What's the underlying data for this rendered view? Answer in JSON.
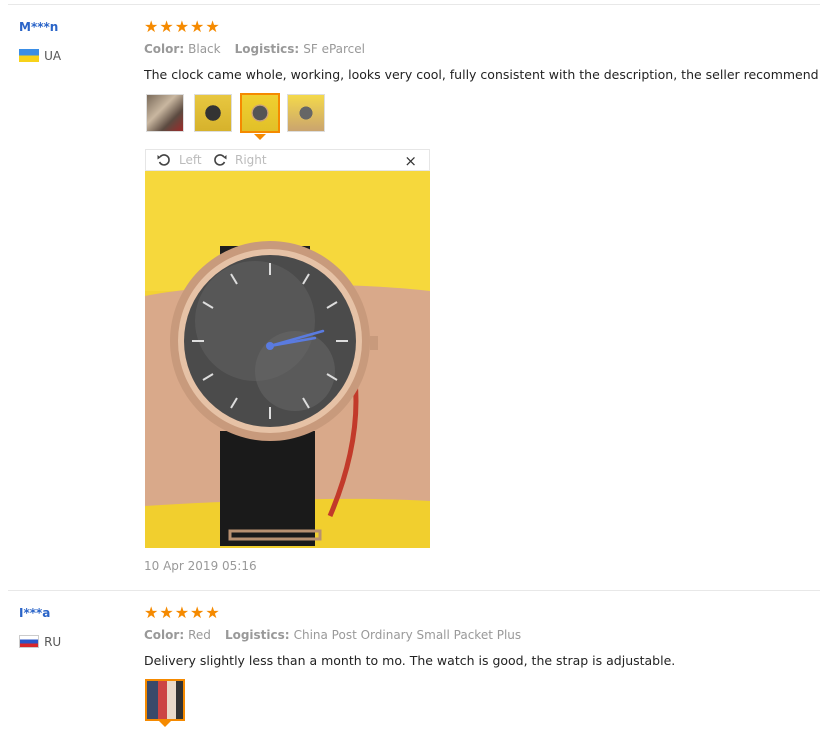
{
  "reviews": [
    {
      "user": "M***n",
      "country": "UA",
      "stars": "★★★★★",
      "color_label": "Color:",
      "color_value": "Black",
      "logistics_label": "Logistics:",
      "logistics_value": "SF eParcel",
      "text": "The clock came whole, working, looks very cool, fully consistent with the description, the seller recommend",
      "date": "10 Apr 2019 05:16",
      "viewer": {
        "left_label": "Left",
        "right_label": "Right",
        "close": "×"
      }
    },
    {
      "user": "I***a",
      "country": "RU",
      "stars": "★★★★★",
      "color_label": "Color:",
      "color_value": "Red",
      "logistics_label": "Logistics:",
      "logistics_value": "China Post Ordinary Small Packet Plus",
      "text": "Delivery slightly less than a month to mo. The watch is good, the strap is adjustable."
    }
  ],
  "colors": {
    "accent": "#f58a00",
    "username": "#2a64c8",
    "photo_bg": "#f3d233"
  }
}
